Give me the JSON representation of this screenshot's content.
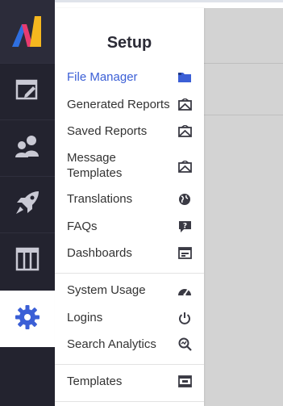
{
  "app": {
    "accent_color": "#3b5fd6",
    "sidebar_color": "#23232f"
  },
  "sidebar": {
    "items": [
      {
        "icon": "editor-window-icon"
      },
      {
        "icon": "users-icon"
      },
      {
        "icon": "rocket-icon"
      },
      {
        "icon": "columns-icon"
      },
      {
        "icon": "gear-icon",
        "active": true
      }
    ]
  },
  "setup_menu": {
    "title": "Setup",
    "groups": [
      [
        {
          "label": "File Manager",
          "icon": "folder-icon",
          "active": true
        },
        {
          "label": "Generated Reports",
          "icon": "envelope-report-icon"
        },
        {
          "label": "Saved Reports",
          "icon": "envelope-report-icon"
        },
        {
          "label": "Message Templates",
          "icon": "envelope-report-icon"
        },
        {
          "label": "Translations",
          "icon": "globe-icon"
        },
        {
          "label": "FAQs",
          "icon": "question-bubble-icon"
        },
        {
          "label": "Dashboards",
          "icon": "dashboard-icon"
        }
      ],
      [
        {
          "label": "System Usage",
          "icon": "gauge-icon"
        },
        {
          "label": "Logins",
          "icon": "power-icon"
        },
        {
          "label": "Search Analytics",
          "icon": "search-analytics-icon"
        }
      ],
      [
        {
          "label": "Templates",
          "icon": "film-template-icon"
        }
      ]
    ]
  }
}
